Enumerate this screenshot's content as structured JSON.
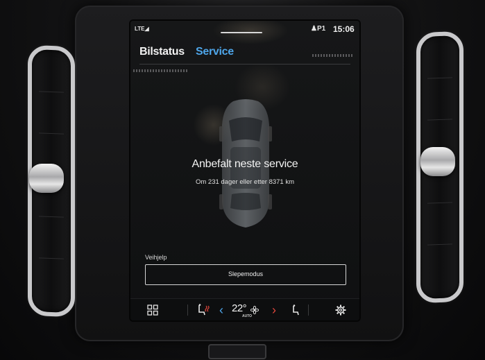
{
  "status_bar": {
    "network": "LTE",
    "profile": "P1",
    "time": "15:06"
  },
  "tabs": [
    {
      "label": "Bilstatus",
      "active": false
    },
    {
      "label": "Service",
      "active": true
    }
  ],
  "service": {
    "title": "Anbefalt neste service",
    "detail": "Om 231 dager eller etter 8371 km"
  },
  "assistance": {
    "label": "Veihjelp",
    "tow_mode_button": "Slepemodus"
  },
  "climate_bar": {
    "temperature": "22°",
    "mode": "AUTO",
    "icons": [
      "app-grid-icon",
      "seat-heat-icon",
      "chevron-left-icon",
      "fan-icon",
      "chevron-right-icon",
      "seat-icon",
      "settings-gear-icon"
    ]
  },
  "colors": {
    "accent": "#4ea6ea",
    "chevron_left": "#4ea6ea",
    "chevron_right": "#e0463c",
    "seat_heat": "#e0463c"
  }
}
